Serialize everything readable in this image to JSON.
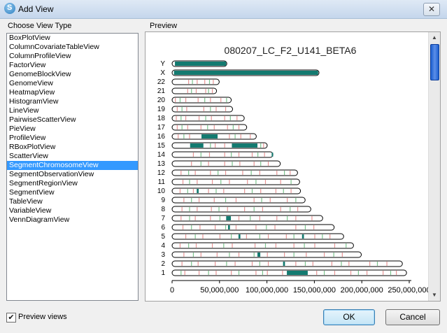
{
  "window": {
    "title": "Add View",
    "close_label": "✕"
  },
  "left_panel": {
    "heading": "Choose View Type",
    "items": [
      "BoxPlotView",
      "ColumnCovariateTableView",
      "ColumnProfileView",
      "FactorView",
      "GenomeBlockView",
      "GenomeView",
      "HeatmapView",
      "HistogramView",
      "LineView",
      "PairwiseScatterView",
      "PieView",
      "ProfileView",
      "RBoxPlotView",
      "ScatterView",
      "SegmentChromosomeView",
      "SegmentObservationView",
      "SegmentRegionView",
      "SegmentView",
      "TableView",
      "VariableView",
      "VennDiagramView"
    ],
    "selected_index": 14
  },
  "preview": {
    "heading": "Preview"
  },
  "footer": {
    "checkbox_label": "Preview views",
    "checkbox_checked": true,
    "ok_label": "OK",
    "cancel_label": "Cancel"
  },
  "colors": {
    "teal": "#137a70",
    "selection": "#3399ff"
  },
  "chart_data": {
    "type": "chromosome_segments",
    "title": "080207_LC_F2_U141_BETA6",
    "x_tick_labels": [
      "0",
      "50,000,000",
      "100,000,000",
      "150,000,000",
      "200,000,000",
      "250,000,000"
    ],
    "xlim": [
      0,
      250000000
    ],
    "chromosomes": [
      {
        "name": "1",
        "length": 247200000,
        "teal": [
          [
            121000000,
            143000000
          ]
        ],
        "red": [
          13,
          28,
          46,
          62,
          88,
          100,
          116,
          152,
          171,
          188,
          205,
          222,
          236
        ],
        "green": [
          9,
          38,
          70,
          95,
          133,
          160,
          196,
          230
        ]
      },
      {
        "name": "2",
        "length": 242800000,
        "teal": [
          [
            117000000,
            119000000
          ]
        ],
        "red": [
          10,
          27,
          45,
          66,
          84,
          101,
          130,
          148,
          168,
          186,
          208,
          226
        ],
        "green": [
          20,
          57,
          92,
          140,
          178,
          216
        ]
      },
      {
        "name": "3",
        "length": 199500000,
        "teal": [
          [
            90000000,
            93000000
          ]
        ],
        "red": [
          12,
          30,
          47,
          70,
          100,
          118,
          141,
          160,
          179
        ],
        "green": [
          22,
          60,
          86,
          128,
          170
        ]
      },
      {
        "name": "4",
        "length": 191300000,
        "teal": [],
        "red": [
          8,
          25,
          42,
          63,
          87,
          109,
          128,
          150,
          171
        ],
        "green": [
          17,
          54,
          98,
          139,
          183
        ]
      },
      {
        "name": "5",
        "length": 180900000,
        "teal": [
          [
            70000000,
            72000000
          ],
          [
            137000000,
            139000000
          ]
        ],
        "red": [
          14,
          32,
          50,
          78,
          101,
          120,
          150,
          166
        ],
        "green": [
          24,
          62,
          92,
          128,
          158
        ]
      },
      {
        "name": "6",
        "length": 170900000,
        "teal": [
          [
            59000000,
            61000000
          ]
        ],
        "red": [
          11,
          29,
          45,
          67,
          88,
          108,
          130,
          149
        ],
        "green": [
          20,
          56,
          99,
          140
        ]
      },
      {
        "name": "7",
        "length": 158800000,
        "teal": [
          [
            57000000,
            62000000
          ]
        ],
        "red": [
          9,
          24,
          40,
          70,
          92,
          110,
          130,
          147
        ],
        "green": [
          18,
          50,
          82,
          121
        ]
      },
      {
        "name": "8",
        "length": 146300000,
        "teal": [],
        "red": [
          10,
          26,
          41,
          58,
          76,
          95,
          114,
          132
        ],
        "green": [
          18,
          49,
          86,
          124
        ]
      },
      {
        "name": "9",
        "length": 140300000,
        "teal": [],
        "red": [
          12,
          28,
          44,
          67,
          86,
          103,
          121
        ],
        "green": [
          20,
          56,
          94,
          130
        ]
      },
      {
        "name": "10",
        "length": 135400000,
        "teal": [
          [
            26000000,
            28000000
          ]
        ],
        "red": [
          8,
          22,
          38,
          54,
          76,
          93,
          109,
          125
        ],
        "green": [
          16,
          46,
          84,
          117
        ]
      },
      {
        "name": "11",
        "length": 134500000,
        "teal": [],
        "red": [
          11,
          26,
          42,
          60,
          79,
          98,
          114
        ],
        "green": [
          18,
          51,
          88,
          125
        ]
      },
      {
        "name": "12",
        "length": 132300000,
        "teal": [],
        "red": [
          9,
          24,
          40,
          56,
          74,
          92,
          110,
          124
        ],
        "green": [
          17,
          48,
          83,
          118
        ]
      },
      {
        "name": "13",
        "length": 114100000,
        "teal": [],
        "red": [
          20,
          38,
          55,
          71,
          86,
          101
        ],
        "green": [
          30,
          63,
          93
        ]
      },
      {
        "name": "14",
        "length": 106300000,
        "teal": [
          [
            105000000,
            106300000
          ]
        ],
        "red": [
          22,
          39,
          55,
          70,
          84,
          97
        ],
        "green": [
          30,
          62,
          90
        ]
      },
      {
        "name": "15",
        "length": 100300000,
        "teal": [
          [
            19000000,
            33000000
          ],
          [
            63000000,
            90000000
          ]
        ],
        "red": [
          22,
          45,
          55,
          96
        ],
        "green": [
          40,
          93
        ]
      },
      {
        "name": "16",
        "length": 88800000,
        "teal": [
          [
            31000000,
            48000000
          ]
        ],
        "red": [
          6,
          18,
          60,
          72,
          82
        ],
        "green": [
          12,
          66
        ]
      },
      {
        "name": "17",
        "length": 78700000,
        "teal": [],
        "red": [
          5,
          16,
          30,
          44,
          58,
          70
        ],
        "green": [
          10,
          37,
          64
        ]
      },
      {
        "name": "18",
        "length": 76100000,
        "teal": [],
        "red": [
          4,
          14,
          28,
          41,
          55,
          68
        ],
        "green": [
          9,
          35,
          61
        ]
      },
      {
        "name": "19",
        "length": 63800000,
        "teal": [],
        "red": [
          5,
          15,
          33,
          46,
          56
        ],
        "green": [
          10,
          40
        ]
      },
      {
        "name": "20",
        "length": 62400000,
        "teal": [],
        "red": [
          3,
          14,
          27,
          40,
          51
        ],
        "green": [
          8,
          34,
          57
        ]
      },
      {
        "name": "21",
        "length": 46900000,
        "teal": [],
        "red": [
          16,
          25,
          35,
          42
        ],
        "green": [
          20,
          38
        ]
      },
      {
        "name": "22",
        "length": 49700000,
        "teal": [],
        "red": [
          17,
          26,
          34,
          43
        ],
        "green": [
          21,
          39
        ]
      },
      {
        "name": "X",
        "length": 154900000,
        "teal": [
          [
            2000000,
            154000000
          ]
        ],
        "red": [],
        "green": []
      },
      {
        "name": "Y",
        "length": 57700000,
        "teal": [
          [
            3000000,
            57000000
          ]
        ],
        "red": [
          26
        ],
        "green": []
      }
    ]
  }
}
